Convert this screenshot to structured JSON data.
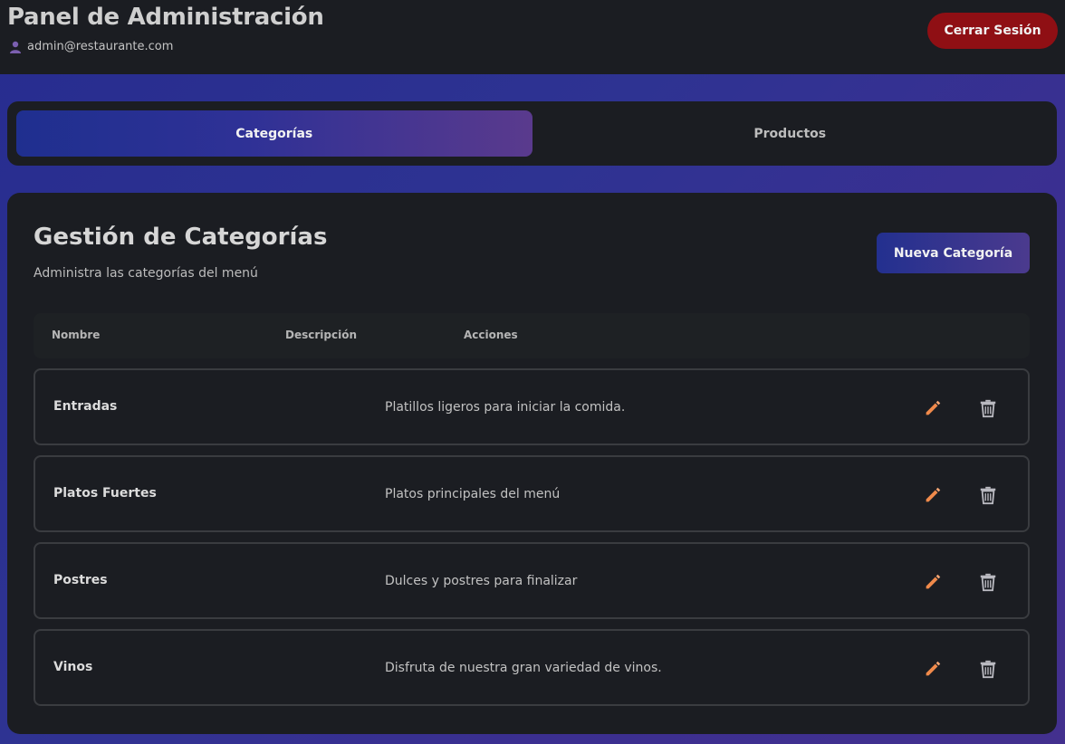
{
  "header": {
    "title": "Panel de Administración",
    "user_email": "admin@restaurante.com",
    "logout_label": "Cerrar Sesión"
  },
  "tabs": [
    {
      "label": "Categorías",
      "active": true
    },
    {
      "label": "Productos",
      "active": false
    }
  ],
  "section": {
    "title": "Gestión de Categorías",
    "subtitle": "Administra las categorías del menú",
    "new_button_label": "Nueva Categoría"
  },
  "table": {
    "columns": [
      "Nombre",
      "Descripción",
      "Acciones"
    ],
    "rows": [
      {
        "name": "Entradas",
        "description": "Platillos ligeros para iniciar la comida."
      },
      {
        "name": "Platos Fuertes",
        "description": "Platos principales del menú"
      },
      {
        "name": "Postres",
        "description": "Dulces y postres para finalizar"
      },
      {
        "name": "Vinos",
        "description": "Disfruta de nuestra gran variedad de vinos."
      }
    ]
  },
  "colors": {
    "accent": "#2f3196",
    "logout": "#8f0f14",
    "edit_icon": "#f08a4b",
    "delete_icon": "#b9b9c0"
  },
  "icons": [
    "user-icon",
    "pencil-icon",
    "trash-icon"
  ]
}
